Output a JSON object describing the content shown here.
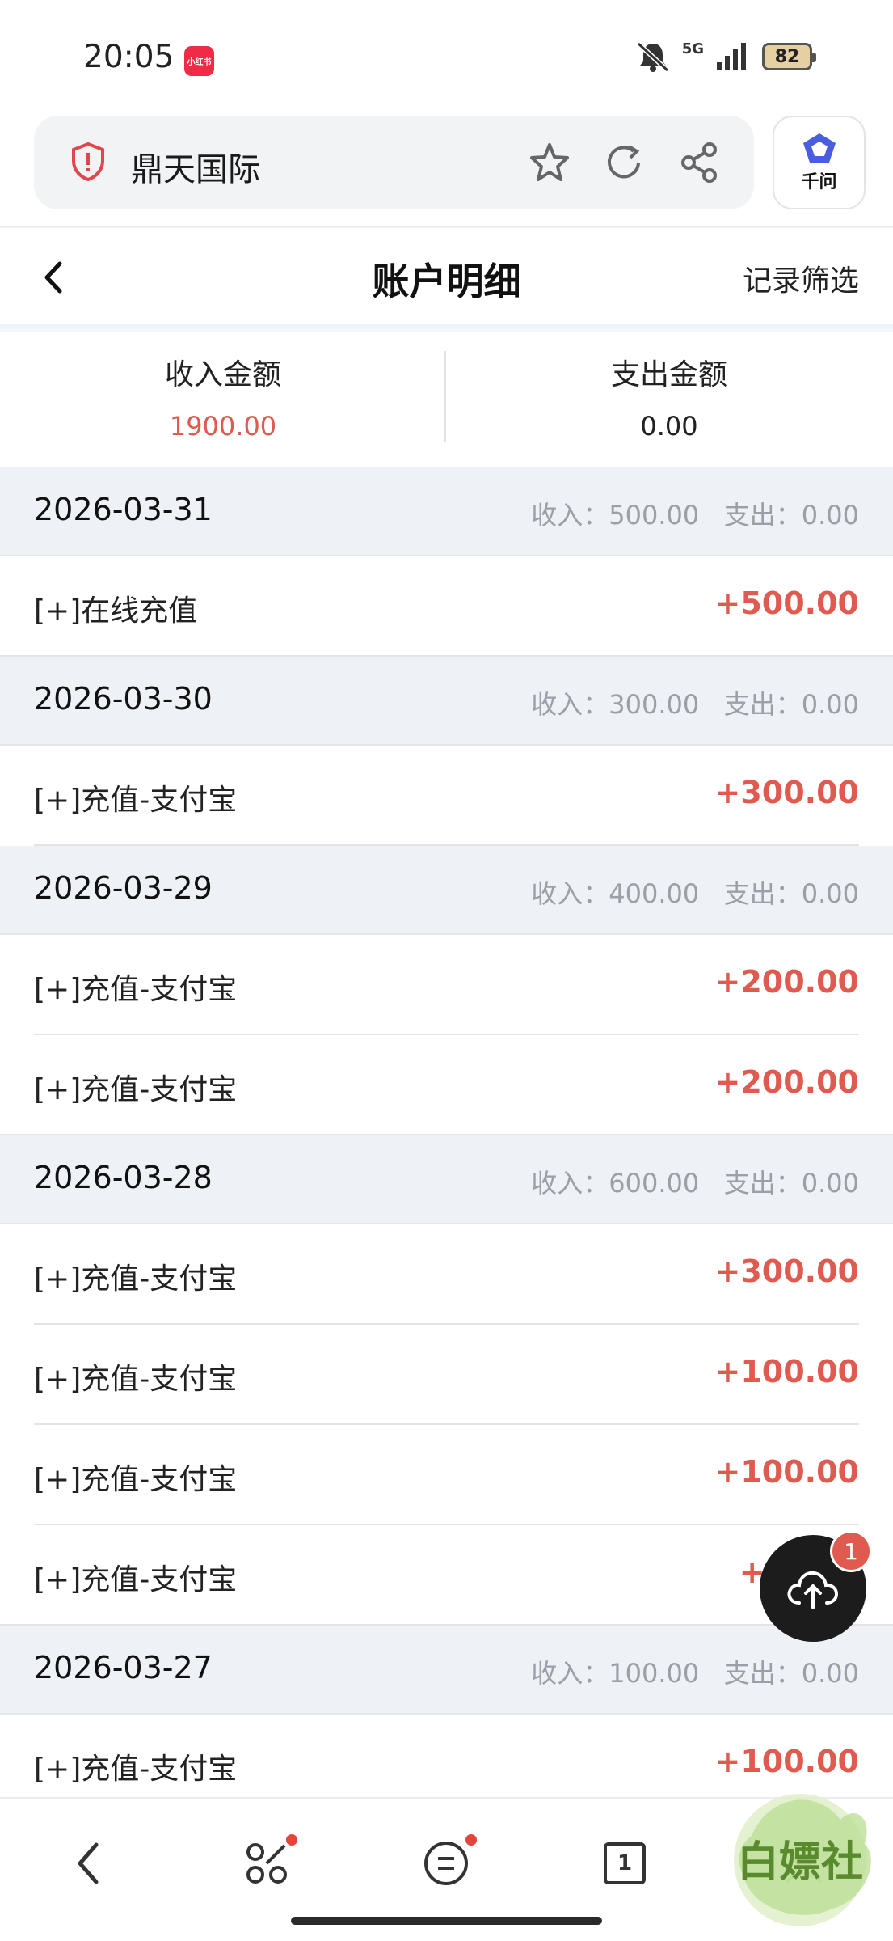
{
  "status_bar": {
    "time": "20:05",
    "app_badge": "小红书",
    "network": "5G",
    "battery": "82"
  },
  "browser": {
    "site_name": "鼎天国际",
    "assistant_label": "千问"
  },
  "header": {
    "title": "账户明细",
    "filter_label": "记录筛选"
  },
  "summary": {
    "income_label": "收入金额",
    "income_value": "1900.00",
    "expense_label": "支出金额",
    "expense_value": "0.00"
  },
  "colors": {
    "income": "#e05a4f",
    "accent": "#3e5bd6"
  },
  "groups": [
    {
      "date": "2026-03-31",
      "summary": "收入：500.00   支出：0.00",
      "items": [
        {
          "label": "[+]在线充值",
          "amount": "+500.00"
        }
      ]
    },
    {
      "date": "2026-03-30",
      "summary": "收入：300.00   支出：0.00",
      "items": [
        {
          "label": "[+]充值-支付宝",
          "amount": "+300.00"
        }
      ]
    },
    {
      "date": "2026-03-29",
      "summary": "收入：400.00   支出：0.00",
      "items": [
        {
          "label": "[+]充值-支付宝",
          "amount": "+200.00"
        },
        {
          "label": "[+]充值-支付宝",
          "amount": "+200.00"
        }
      ]
    },
    {
      "date": "2026-03-28",
      "summary": "收入：600.00   支出：0.00",
      "items": [
        {
          "label": "[+]充值-支付宝",
          "amount": "+300.00"
        },
        {
          "label": "[+]充值-支付宝",
          "amount": "+100.00"
        },
        {
          "label": "[+]充值-支付宝",
          "amount": "+100.00"
        },
        {
          "label": "[+]充值-支付宝",
          "amount": "+1"
        }
      ]
    },
    {
      "date": "2026-03-27",
      "summary": "收入：100.00   支出：0.00",
      "items": [
        {
          "label": "[+]充值-支付宝",
          "amount": "+100.00"
        }
      ]
    }
  ],
  "fab": {
    "badge": "1",
    "icon": "cloud-upload-icon"
  },
  "bottom_nav": {
    "tab_count": "1"
  },
  "watermark": {
    "text": "白嫖社"
  }
}
